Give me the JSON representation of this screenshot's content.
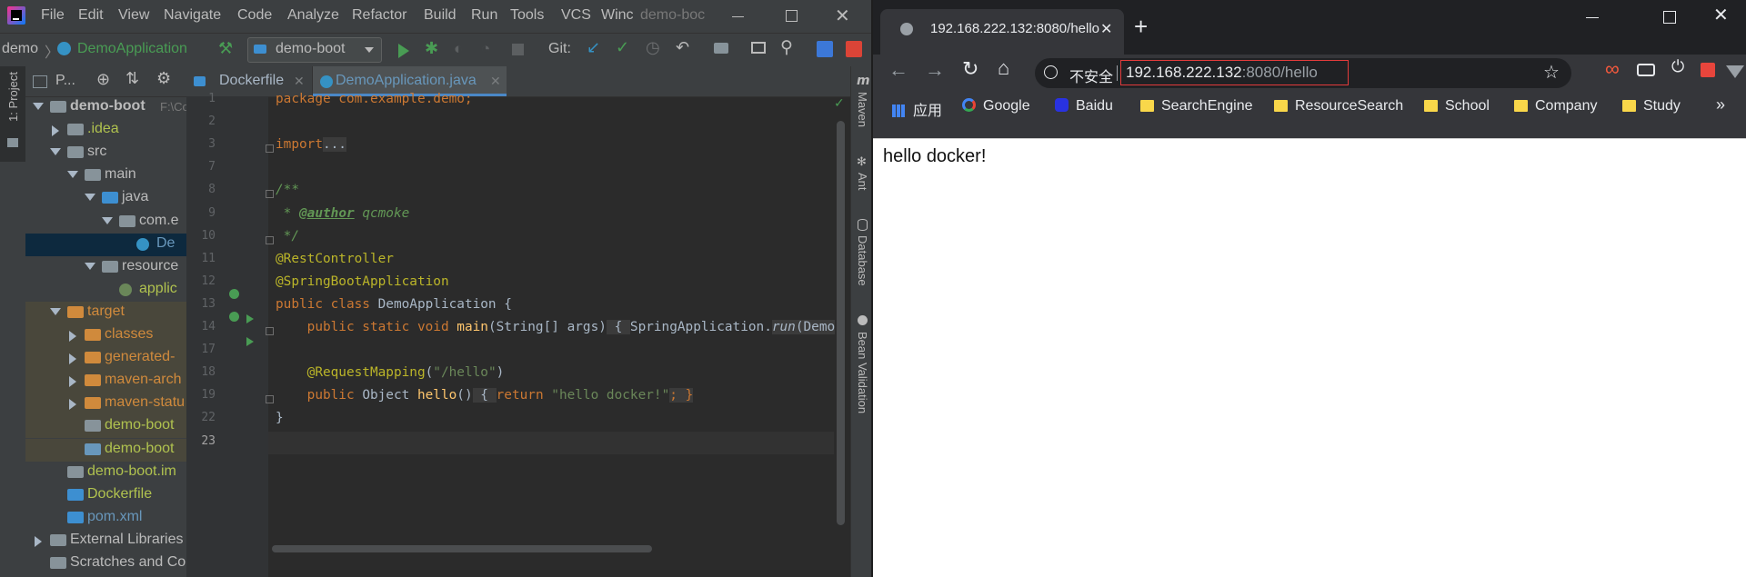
{
  "ide": {
    "menu": [
      "File",
      "Edit",
      "View",
      "Navigate",
      "Code",
      "Analyze",
      "Refactor",
      "Build",
      "Run",
      "Tools",
      "VCS",
      "Winc"
    ],
    "window_title": "demo-boc",
    "breadcrumb": [
      "demo",
      "DemoApplication"
    ],
    "run_config": "demo-boot",
    "git_label": "Git:",
    "left_tool_window": "1: Project",
    "project_header": "P...",
    "tree": [
      {
        "label": "demo-boot",
        "suffix": "F:\\Co",
        "indent": 0,
        "arrow": "down",
        "type": "module",
        "bold": true
      },
      {
        "label": ".idea",
        "indent": 1,
        "arrow": "right",
        "type": "folder-plain",
        "color": "#b0c24f"
      },
      {
        "label": "src",
        "indent": 1,
        "arrow": "down",
        "type": "folder-plain"
      },
      {
        "label": "main",
        "indent": 2,
        "arrow": "down",
        "type": "folder-plain"
      },
      {
        "label": "java",
        "indent": 3,
        "arrow": "down",
        "type": "folder-blue"
      },
      {
        "label": "com.e",
        "indent": 4,
        "arrow": "down",
        "type": "package"
      },
      {
        "label": "De",
        "indent": 5,
        "arrow": "none",
        "type": "class",
        "selected": true,
        "color": "#6897bb"
      },
      {
        "label": "resource",
        "indent": 3,
        "arrow": "down",
        "type": "folder-res"
      },
      {
        "label": "applic",
        "indent": 4,
        "arrow": "none",
        "type": "props",
        "color": "#b0c24f"
      },
      {
        "label": "target",
        "indent": 1,
        "arrow": "down",
        "type": "folder-orange",
        "color": "#d08a3c",
        "excluded": true
      },
      {
        "label": "classes",
        "indent": 2,
        "arrow": "right",
        "type": "folder-orange",
        "color": "#d08a3c",
        "excluded": true
      },
      {
        "label": "generated-",
        "indent": 2,
        "arrow": "right",
        "type": "folder-orange",
        "color": "#d08a3c",
        "excluded": true
      },
      {
        "label": "maven-arch",
        "indent": 2,
        "arrow": "right",
        "type": "folder-orange",
        "color": "#d08a3c",
        "excluded": true
      },
      {
        "label": "maven-statu",
        "indent": 2,
        "arrow": "right",
        "type": "folder-orange",
        "color": "#d08a3c",
        "excluded": true
      },
      {
        "label": "demo-boot",
        "indent": 2,
        "arrow": "none",
        "type": "jar",
        "color": "#b0c24f",
        "excluded": true
      },
      {
        "label": "demo-boot",
        "indent": 2,
        "arrow": "none",
        "type": "jar2",
        "color": "#b0c24f",
        "excluded": true
      },
      {
        "label": "demo-boot.im",
        "indent": 1,
        "arrow": "none",
        "type": "iml",
        "color": "#b0c24f"
      },
      {
        "label": "Dockerfile",
        "indent": 1,
        "arrow": "none",
        "type": "docker",
        "color": "#b0c24f"
      },
      {
        "label": "pom.xml",
        "indent": 1,
        "arrow": "none",
        "type": "maven",
        "color": "#6897bb"
      },
      {
        "label": "External Libraries",
        "indent": 0,
        "arrow": "right",
        "type": "libs"
      },
      {
        "label": "Scratches and Cor",
        "indent": 0,
        "arrow": "none",
        "type": "scratch"
      }
    ],
    "tabs": [
      {
        "label": "Dockerfile",
        "active": false
      },
      {
        "label": "DemoApplication.java",
        "active": true
      }
    ],
    "line_numbers": [
      "1",
      "2",
      "3",
      "7",
      "8",
      "9",
      "10",
      "11",
      "12",
      "13",
      "14",
      "17",
      "18",
      "19",
      "22",
      "23"
    ],
    "code": {
      "l1": [
        "package com.example.demo;"
      ],
      "l3": [
        "import",
        "..."
      ],
      "l8": [
        "/**"
      ],
      "l9": [
        " * ",
        "@author",
        " qcmoke"
      ],
      "l10": [
        " */"
      ],
      "l11": [
        "@RestController"
      ],
      "l12": [
        "@SpringBootApplication"
      ],
      "l13": [
        "public class ",
        "DemoApplication",
        " {"
      ],
      "l14": [
        "    public static void ",
        "main",
        "(String[] args)",
        " { ",
        "SpringApplication.",
        "run",
        "(Demo"
      ],
      "l18": [
        "    ",
        "@RequestMapping",
        "(",
        "\"/hello\"",
        ")"
      ],
      "l19": [
        "    public ",
        "Object ",
        "hello",
        "()",
        " { ",
        "return ",
        "\"hello docker!\"",
        "; }"
      ],
      "l22": [
        "}"
      ]
    },
    "right_tools": [
      "Maven",
      "Ant",
      "Database",
      "Bean Validation"
    ]
  },
  "browser": {
    "tab_title": "192.168.222.132:8080/hello",
    "security_label": "不安全",
    "url_host": "192.168.222.132",
    "url_rest": ":8080/hello",
    "bookmarks": [
      "应用",
      "Google",
      "Baidu",
      "SearchEngine",
      "ResourceSearch",
      "School",
      "Company",
      "Study"
    ],
    "more": "»",
    "page_text": "hello docker!"
  },
  "colors": {
    "ide_bg": "#2b2b2b",
    "ide_panel": "#3c3f41",
    "accent_green": "#499c54",
    "keyword": "#cc7832",
    "annotation": "#bbb529",
    "string": "#6a8759",
    "comment": "#629755",
    "method": "#ffc66d",
    "url_highlight": "#e33b3b"
  }
}
